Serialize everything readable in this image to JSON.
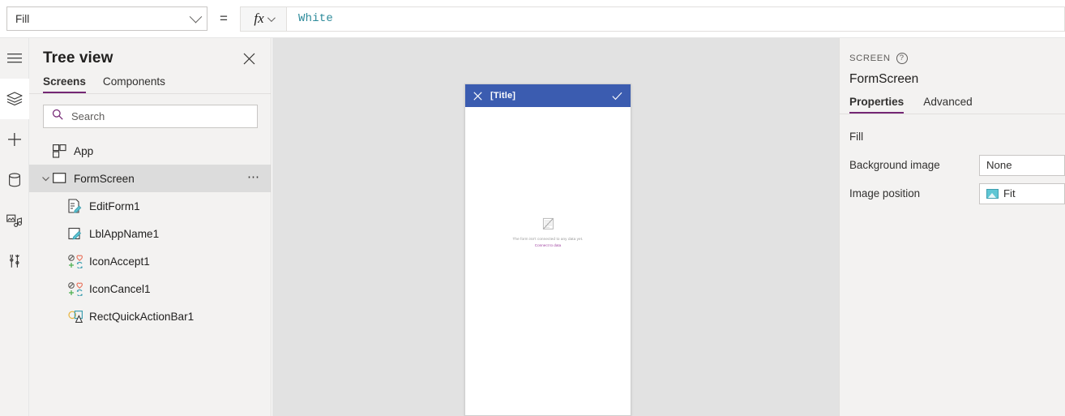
{
  "formula_bar": {
    "property_name": "Fill",
    "equals_sign": "=",
    "fx_label": "fx",
    "formula_value": "White"
  },
  "rail": {
    "items": [
      {
        "name": "hamburger-menu-icon",
        "label": "Menu"
      },
      {
        "name": "tree-view-icon",
        "label": "Tree view"
      },
      {
        "name": "insert-icon",
        "label": "Insert"
      },
      {
        "name": "data-icon",
        "label": "Data"
      },
      {
        "name": "media-icon",
        "label": "Media"
      },
      {
        "name": "advanced-tools-icon",
        "label": "Advanced tools"
      }
    ]
  },
  "tree_view": {
    "title": "Tree view",
    "close_label": "Close",
    "tabs": [
      {
        "label": "Screens",
        "active": true
      },
      {
        "label": "Components",
        "active": false
      }
    ],
    "search": {
      "placeholder": "Search",
      "value": ""
    },
    "items": [
      {
        "label": "App",
        "icon": "app-icon",
        "indent": 0,
        "selected": false,
        "expandable": false,
        "overflow": false
      },
      {
        "label": "FormScreen",
        "icon": "screen-icon",
        "indent": 0,
        "selected": true,
        "expandable": true,
        "overflow": true
      },
      {
        "label": "EditForm1",
        "icon": "editform-icon",
        "indent": 1,
        "selected": false,
        "expandable": false,
        "overflow": false
      },
      {
        "label": "LblAppName1",
        "icon": "label-icon",
        "indent": 1,
        "selected": false,
        "expandable": false,
        "overflow": false
      },
      {
        "label": "IconAccept1",
        "icon": "icons-icon",
        "indent": 1,
        "selected": false,
        "expandable": false,
        "overflow": false
      },
      {
        "label": "IconCancel1",
        "icon": "icons-icon",
        "indent": 1,
        "selected": false,
        "expandable": false,
        "overflow": false
      },
      {
        "label": "RectQuickActionBar1",
        "icon": "shapes-icon",
        "indent": 1,
        "selected": false,
        "expandable": false,
        "overflow": false
      }
    ]
  },
  "canvas": {
    "app_bar": {
      "title": "[Title]",
      "cancel_icon": "close-icon",
      "accept_icon": "checkmark-icon",
      "background_color": "#3b5cb0"
    },
    "form_placeholder": {
      "icon": "form-placeholder-icon",
      "message": "The form isn't connected to any data yet.",
      "link_text": "Connect to data",
      "link_color": "#a349a4"
    }
  },
  "properties_panel": {
    "kicker": "SCREEN",
    "help_icon": "help-icon",
    "help_glyph": "?",
    "control_name": "FormScreen",
    "tabs": [
      {
        "label": "Properties",
        "active": true
      },
      {
        "label": "Advanced",
        "active": false
      }
    ],
    "rows": [
      {
        "label": "Fill",
        "value": null,
        "field": false
      },
      {
        "label": "Background image",
        "value": "None",
        "field": true,
        "icon": null
      },
      {
        "label": "Image position",
        "value": "Fit",
        "field": true,
        "icon": "image-icon"
      }
    ]
  },
  "theme": {
    "accent_purple": "#742774",
    "panel_bg": "#f3f2f1",
    "canvas_bg": "#e2e2e2",
    "formula_text": "#2e8b9b",
    "selected_row": "#dcdcdc"
  }
}
